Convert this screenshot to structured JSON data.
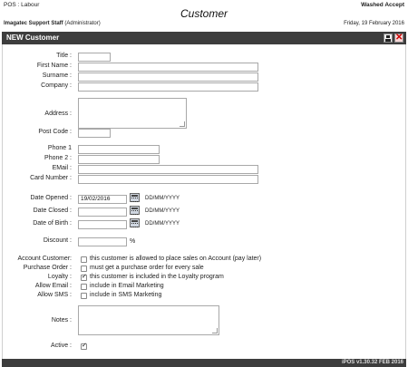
{
  "header": {
    "app_line": "POS : Labour",
    "title": "Customer",
    "status": "Washed Accept",
    "user": "Imagatec Support Staff",
    "role": "(Administrator)",
    "date": "Friday, 19 February 2016"
  },
  "panel": {
    "title": "NEW Customer",
    "save_icon": "save-disk-icon",
    "close_icon": "close-x-icon"
  },
  "form": {
    "title_label": "Title :",
    "title_value": "",
    "first_name_label": "First Name :",
    "first_name_value": "",
    "surname_label": "Surname :",
    "surname_value": "",
    "company_label": "Company :",
    "company_value": "",
    "address_label": "Address :",
    "address_value": "",
    "post_code_label": "Post Code :",
    "post_code_value": "",
    "phone1_label": "Phone 1",
    "phone1_value": "",
    "phone2_label": "Phone 2 :",
    "phone2_value": "",
    "email_label": "EMail :",
    "email_value": "",
    "card_number_label": "Card Number :",
    "card_number_value": "",
    "date_opened_label": "Date Opened :",
    "date_opened_value": "19/02/2016",
    "date_closed_label": "Date Closed :",
    "date_closed_value": "",
    "dob_label": "Date of Birth :",
    "dob_value": "",
    "date_format_hint": "DD/MM/YYYY",
    "discount_label": "Discount :",
    "discount_value": "",
    "discount_unit": "%",
    "account_customer_label": "Account Customer:",
    "account_customer_text": "this customer is allowed to place sales on Account (pay later)",
    "account_customer_checked": false,
    "purchase_order_label": "Purchase Order :",
    "purchase_order_text": "must get a purchase order for every sale",
    "purchase_order_checked": false,
    "loyalty_label": "Loyalty :",
    "loyalty_text": "this customer is included in the Loyalty program",
    "loyalty_checked": true,
    "allow_email_label": "Allow Email :",
    "allow_email_text": "include in Email Marketing",
    "allow_email_checked": false,
    "allow_sms_label": "Allow SMS :",
    "allow_sms_text": "include in SMS Marketing",
    "allow_sms_checked": false,
    "notes_label": "Notes :",
    "notes_value": "",
    "active_label": "Active :",
    "active_checked": true
  },
  "footer": {
    "version": "iPOS v1.30.32 FEB 2016"
  }
}
